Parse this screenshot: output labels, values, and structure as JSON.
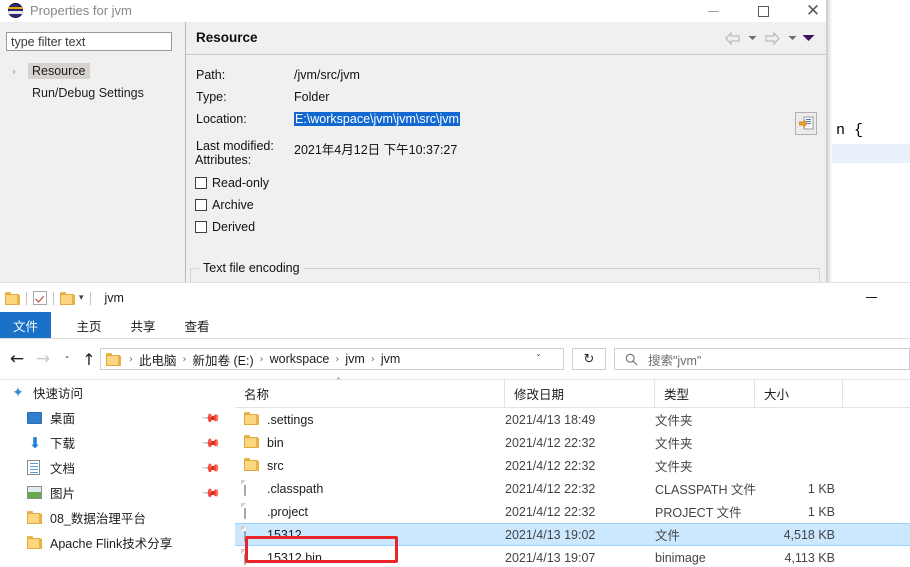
{
  "eclipse_editor": {
    "code_fragment": "n {"
  },
  "dialog": {
    "title": "Properties for jvm",
    "icon": "eclipse-globe-icon",
    "window_buttons": {
      "minimize": "minimize-icon",
      "maximize": "maximize-icon",
      "close": "close-icon"
    },
    "filter": {
      "placeholder": "type filter text",
      "value": "type filter text"
    },
    "tree": [
      {
        "label": "Resource",
        "selected": true,
        "expander": "›"
      },
      {
        "label": "Run/Debug Settings",
        "selected": false,
        "expander": ""
      }
    ],
    "page": {
      "title": "Resource",
      "nav": {
        "back": "back-arrow-icon",
        "back_menu": "chevron-down-icon",
        "forward": "forward-arrow-icon",
        "forward_menu": "chevron-down-icon",
        "view_menu": "view-menu-icon"
      },
      "fields": [
        {
          "label": "Path:",
          "value": "/jvm/src/jvm",
          "selected": false
        },
        {
          "label": "Type:",
          "value": "Folder",
          "selected": false
        },
        {
          "label": "Location:",
          "value": "E:\\workspace\\jvm\\jvm\\src\\jvm",
          "selected": true
        },
        {
          "label": "Last modified:",
          "value": "2021年4月12日 下午10:37:27",
          "selected": false
        }
      ],
      "browse_button": "edit-location-icon",
      "attributes_label": "Attributes:",
      "checkboxes": [
        {
          "label": "Read-only",
          "checked": false
        },
        {
          "label": "Archive",
          "checked": false
        },
        {
          "label": "Derived",
          "checked": false
        }
      ],
      "group_label": "Text file encoding"
    }
  },
  "explorer": {
    "window_title": "jvm",
    "quick_access": [
      {
        "name": "folder-icon"
      },
      {
        "name": "properties-check-icon"
      },
      {
        "name": "new-folder-icon"
      }
    ],
    "qat_caret": "▾",
    "minimize": "minimize-icon",
    "ribbon_tabs": [
      {
        "label": "文件",
        "active": true
      },
      {
        "label": "主页",
        "active": false
      },
      {
        "label": "共享",
        "active": false
      },
      {
        "label": "查看",
        "active": false
      }
    ],
    "nav_buttons": {
      "back": "←",
      "forward": "→",
      "history": "ˇ",
      "up": "↑"
    },
    "breadcrumb": [
      "此电脑",
      "新加卷 (E:)",
      "workspace",
      "jvm",
      "jvm"
    ],
    "breadcrumb_separator": "›",
    "breadcrumb_caret": "ˇ",
    "refresh_icon": "↻",
    "search": {
      "icon": "search-icon",
      "placeholder": "搜索\"jvm\""
    },
    "nav_pane": [
      {
        "label": "快速访问",
        "icon": "star-icon",
        "indent": 10,
        "pinned": false
      },
      {
        "label": "桌面",
        "icon": "desktop-icon",
        "indent": 27,
        "pinned": true
      },
      {
        "label": "下载",
        "icon": "download-icon",
        "indent": 27,
        "pinned": true
      },
      {
        "label": "文档",
        "icon": "documents-icon",
        "indent": 27,
        "pinned": true
      },
      {
        "label": "图片",
        "icon": "pictures-icon",
        "indent": 27,
        "pinned": true
      },
      {
        "label": "08_数据治理平台",
        "icon": "folder-icon",
        "indent": 27,
        "pinned": false
      },
      {
        "label": "Apache Flink技术分享",
        "icon": "folder-icon",
        "indent": 27,
        "pinned": false
      }
    ],
    "columns": [
      {
        "label": "名称",
        "sorted": "asc"
      },
      {
        "label": "修改日期",
        "sorted": ""
      },
      {
        "label": "类型",
        "sorted": ""
      },
      {
        "label": "大小",
        "sorted": ""
      }
    ],
    "sort_caret": "˄",
    "files": [
      {
        "name": ".settings",
        "date": "2021/4/13 18:49",
        "type": "文件夹",
        "size": "",
        "icon": "folder-icon",
        "selected": false,
        "annotated": false
      },
      {
        "name": "bin",
        "date": "2021/4/12 22:32",
        "type": "文件夹",
        "size": "",
        "icon": "folder-icon",
        "selected": false,
        "annotated": false
      },
      {
        "name": "src",
        "date": "2021/4/12 22:32",
        "type": "文件夹",
        "size": "",
        "icon": "folder-icon",
        "selected": false,
        "annotated": false
      },
      {
        "name": ".classpath",
        "date": "2021/4/12 22:32",
        "type": "CLASSPATH 文件",
        "size": "1 KB",
        "icon": "file-icon",
        "selected": false,
        "annotated": false
      },
      {
        "name": ".project",
        "date": "2021/4/12 22:32",
        "type": "PROJECT 文件",
        "size": "1 KB",
        "icon": "file-icon",
        "selected": false,
        "annotated": false
      },
      {
        "name": "15312",
        "date": "2021/4/13 19:02",
        "type": "文件",
        "size": "4,518 KB",
        "icon": "file-icon",
        "selected": true,
        "annotated": false
      },
      {
        "name": "15312.bin",
        "date": "2021/4/13 19:07",
        "type": "binimage",
        "size": "4,113 KB",
        "icon": "file-icon",
        "selected": false,
        "annotated": true
      }
    ]
  },
  "colors": {
    "selection_blue": "#cce8ff",
    "annotation_red": "#e8262a",
    "ribbon_file_blue": "#1b70c8",
    "text_selection": "#1268d1"
  }
}
